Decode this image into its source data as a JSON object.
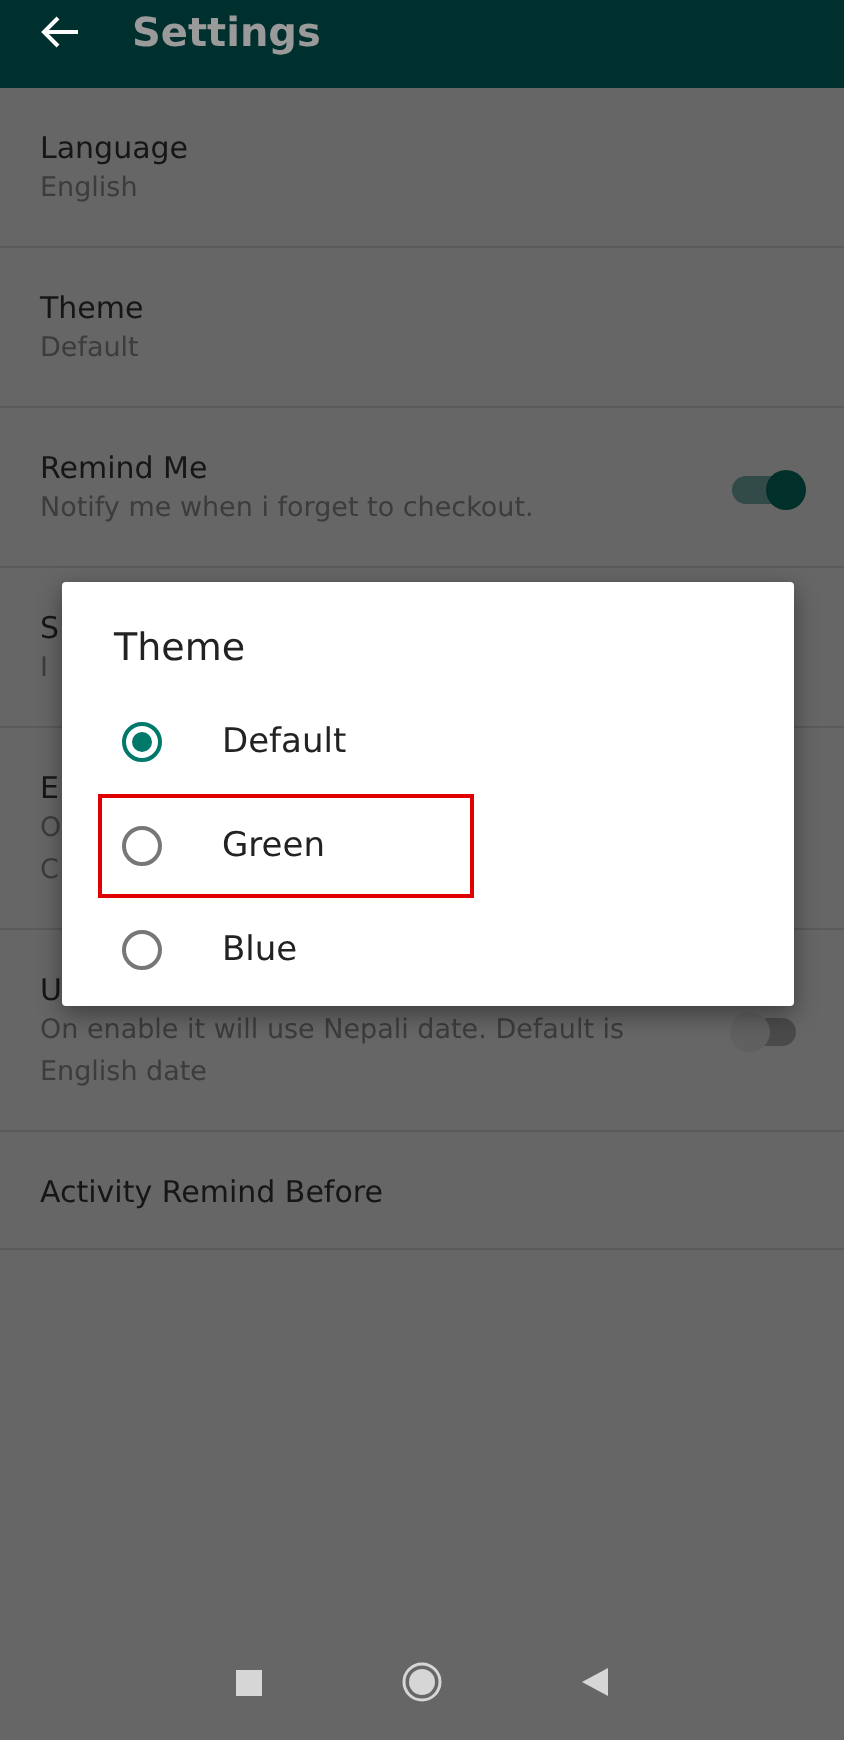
{
  "app_bar": {
    "title": "Settings"
  },
  "settings": [
    {
      "title": "Language",
      "lines": [
        "English"
      ]
    },
    {
      "title": "Theme",
      "lines": [
        "Default"
      ]
    },
    {
      "title": "Remind Me",
      "lines": [
        "Notify me when i forget to checkout."
      ],
      "toggle": {
        "on": true
      }
    },
    {
      "title": "S",
      "lines": [
        "I"
      ]
    },
    {
      "title": "E",
      "lines": [
        "O",
        "C"
      ]
    },
    {
      "title": "U",
      "lines": [
        "On enable it will use Nepali date. Default is",
        "English date"
      ],
      "toggle": {
        "on": false
      }
    },
    {
      "title": "Activity Remind Before"
    }
  ],
  "dialog": {
    "title": "Theme",
    "options": [
      {
        "label": "Default",
        "selected": true,
        "highlighted": false
      },
      {
        "label": "Green",
        "selected": false,
        "highlighted": true
      },
      {
        "label": "Blue",
        "selected": false,
        "highlighted": false
      }
    ]
  }
}
